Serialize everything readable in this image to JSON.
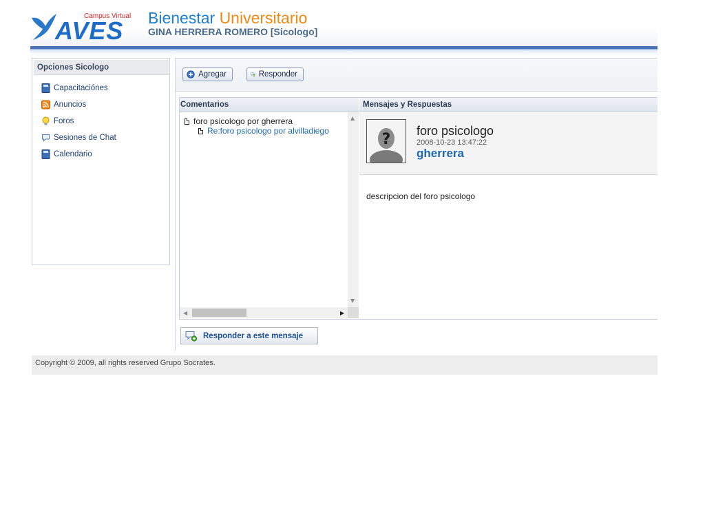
{
  "header": {
    "logo_small_text": "Campus Virtual",
    "logo_text": "AVES",
    "app_title_part1": "Bienestar",
    "app_title_part2": "Universitario",
    "user_line": "GINA HERRERA ROMERO [Sicologo]"
  },
  "sidebar": {
    "title": "Opciones Sicologo",
    "items": [
      {
        "label": "Capacitaciónes",
        "icon": "book-icon"
      },
      {
        "label": "Anuncios",
        "icon": "rss-icon"
      },
      {
        "label": "Foros",
        "icon": "lightbulb-icon"
      },
      {
        "label": "Sesiones de Chat",
        "icon": "chat-bubble-icon"
      },
      {
        "label": "Calendario",
        "icon": "book-icon"
      }
    ]
  },
  "toolbar": {
    "add_label": "Agregar",
    "reply_label": "Responder"
  },
  "comments": {
    "title": "Comentarios",
    "items": [
      {
        "label": "foro psicologo por gherrera",
        "level": 0
      },
      {
        "label": "Re:foro psicologo por alvilladiego",
        "level": 1
      }
    ]
  },
  "messages": {
    "title": "Mensajes y Respuestas",
    "message": {
      "title": "foro psicologo",
      "date": "2008-10-23 13:47:22",
      "author": "gherrera",
      "body": "descripcion del foro psicologo"
    }
  },
  "reply_button_label": "Responder a este mensaje",
  "footer": {
    "copyright": "Copyright © 2009, all rights reserved Grupo Socrates."
  },
  "colors": {
    "brand_blue": "#1d7fcf",
    "brand_orange": "#f08a14",
    "link_blue": "#1e6ab0"
  }
}
